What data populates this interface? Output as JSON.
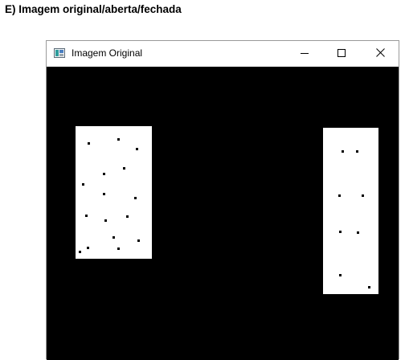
{
  "heading": "E) Imagem original/aberta/fechada",
  "window": {
    "title": "Imagem Original",
    "icons": {
      "app": "image-app-icon",
      "minimize": "minimize-icon",
      "maximize": "maximize-icon",
      "close": "close-icon"
    }
  },
  "image": {
    "background_color": "#000000",
    "shape_color": "#ffffff",
    "shapes": [
      {
        "name": "left-rectangle",
        "noise_dots": 16
      },
      {
        "name": "right-rectangle",
        "noise_dots": 9
      }
    ]
  }
}
